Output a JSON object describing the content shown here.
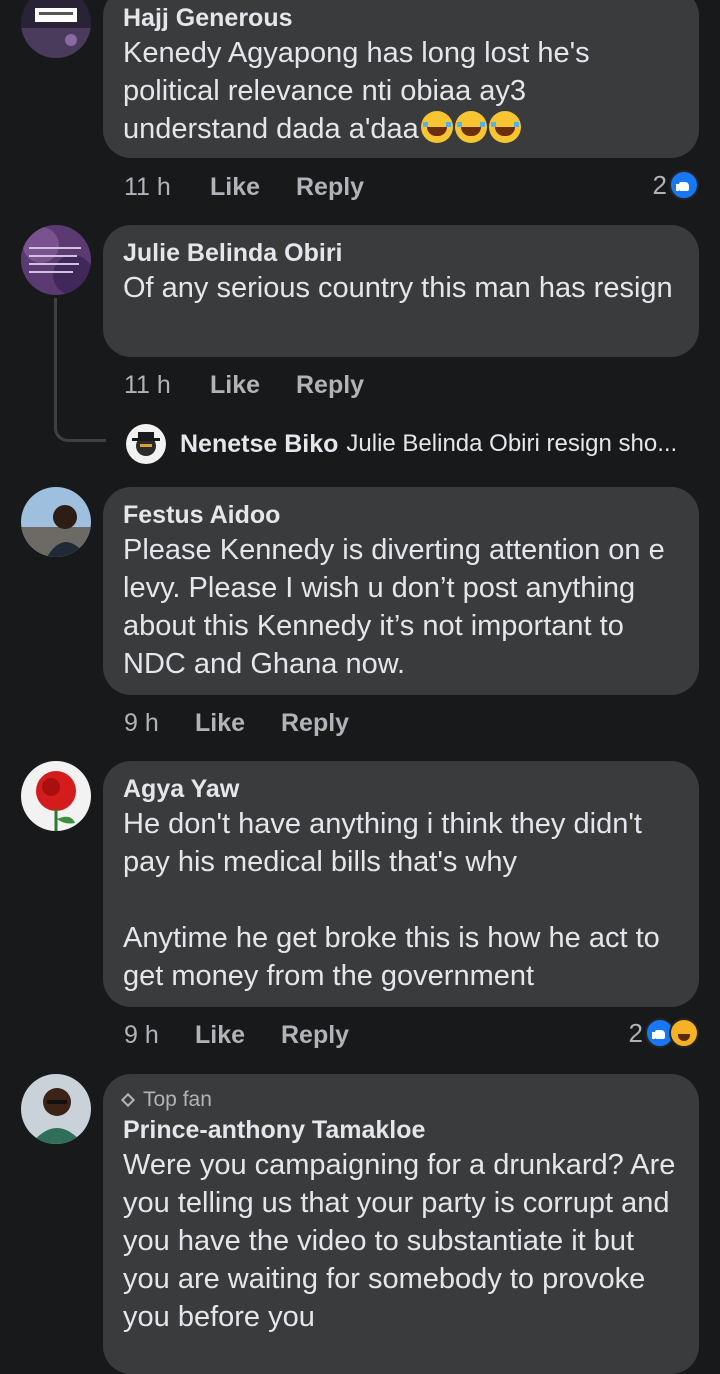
{
  "comments": [
    {
      "author": "Hajj Generous",
      "text": "Kenedy Agyapong has long lost he's political relevance nti obiaa ay3 understand dada a'daa",
      "emojis": [
        "tears-of-joy-emoji",
        "tears-of-joy-emoji",
        "tears-of-joy-emoji"
      ],
      "time": "11 h",
      "like": "Like",
      "reply": "Reply",
      "reaction_count": "2",
      "reactions": [
        "like-icon"
      ]
    },
    {
      "author": "Julie Belinda Obiri",
      "text": "Of any serious country this man has resign",
      "time": "11 h",
      "like": "Like",
      "reply": "Reply",
      "reply_preview": {
        "author": "Nenetse Biko",
        "text": "Julie Belinda Obiri resign sho..."
      }
    },
    {
      "author": "Festus Aidoo",
      "text": "Please Kennedy is diverting attention on e levy. Please I wish u don’t post anything about this Kennedy it’s not important to NDC and Ghana now.",
      "time": "9 h",
      "like": "Like",
      "reply": "Reply"
    },
    {
      "author": "Agya Yaw",
      "text": "He don't have anything i think they didn't pay his medical bills that's why\n\nAnytime he get broke this is how he act to get money from the government",
      "time": "9 h",
      "like": "Like",
      "reply": "Reply",
      "reaction_count": "2",
      "reactions": [
        "like-icon",
        "haha-icon"
      ]
    },
    {
      "badge": "Top fan",
      "author": "Prince-anthony Tamakloe",
      "text": "Were you campaigning for a drunkard? Are you telling us that your party is corrupt and you have the video to substantiate it but you are waiting for somebody to provoke you before you"
    }
  ]
}
